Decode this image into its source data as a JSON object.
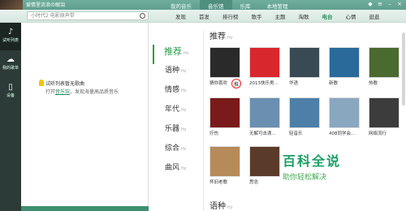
{
  "user": {
    "name": "爱情里流浪の眼泪"
  },
  "top_tabs": [
    {
      "label": "我的音乐"
    },
    {
      "label": "音乐馆"
    },
    {
      "label": "乐库"
    },
    {
      "label": "本地管理"
    }
  ],
  "search": {
    "placeholder": "小时代2 电影原声带"
  },
  "sub_tabs": [
    {
      "label": "发现"
    },
    {
      "label": "首发"
    },
    {
      "label": "排行榜"
    },
    {
      "label": "歌手"
    },
    {
      "label": "主题"
    },
    {
      "label": "淘歌"
    },
    {
      "label": "电台"
    },
    {
      "label": "心情"
    },
    {
      "label": "逛逛"
    }
  ],
  "rail": [
    {
      "label": "试听列表",
      "icon": "music-note-icon"
    },
    {
      "label": "我的歌单",
      "icon": "cloud-icon"
    },
    {
      "label": "设备",
      "icon": "device-icon"
    }
  ],
  "playlist": {
    "empty_title": "试听列表暂无歌曲",
    "empty_prefix": "打开",
    "empty_link": "音乐馆",
    "empty_suffix": "，发现海量高品质音乐"
  },
  "categories": [
    {
      "label": "推荐",
      "hz": "Hz"
    },
    {
      "label": "语种",
      "hz": "Hz"
    },
    {
      "label": "情感",
      "hz": "Hz"
    },
    {
      "label": "年代",
      "hz": "Hz"
    },
    {
      "label": "乐器",
      "hz": "Hz"
    },
    {
      "label": "综合",
      "hz": "Hz"
    },
    {
      "label": "曲风",
      "hz": "Hz"
    }
  ],
  "section_recommend": {
    "title": "推荐",
    "hz": "Hz"
  },
  "section_language": {
    "title": "语种",
    "hz": "Hz"
  },
  "tiles": [
    {
      "label": "猜你喜欢",
      "color": "#2a2a2a"
    },
    {
      "label": "2013快乐男...",
      "color": "#d9272e"
    },
    {
      "label": "华语",
      "color": "#3a4a55"
    },
    {
      "label": "新歌",
      "color": "#2a6a9a"
    },
    {
      "label": "热歌",
      "color": "#4a6a30"
    },
    {
      "label": "疗伤",
      "color": "#7a1a1a"
    },
    {
      "label": "无解可击滴...",
      "color": "#6a8fb0"
    },
    {
      "label": "轻音乐",
      "color": "#4d7fa8"
    },
    {
      "label": "408同学会...",
      "color": "#8aa7c0"
    },
    {
      "label": "网络流行",
      "color": "#3c3c3c"
    },
    {
      "label": "怀旧老歌",
      "color": "#b78a5a"
    },
    {
      "label": "思念",
      "color": "#5a3b2a"
    }
  ],
  "annotation_label": "推",
  "watermark": {
    "big": "百科全说",
    "small": "助你轻松解决"
  },
  "colors": {
    "accent": "#2a9c4c",
    "topbar": "#6fae9c"
  }
}
